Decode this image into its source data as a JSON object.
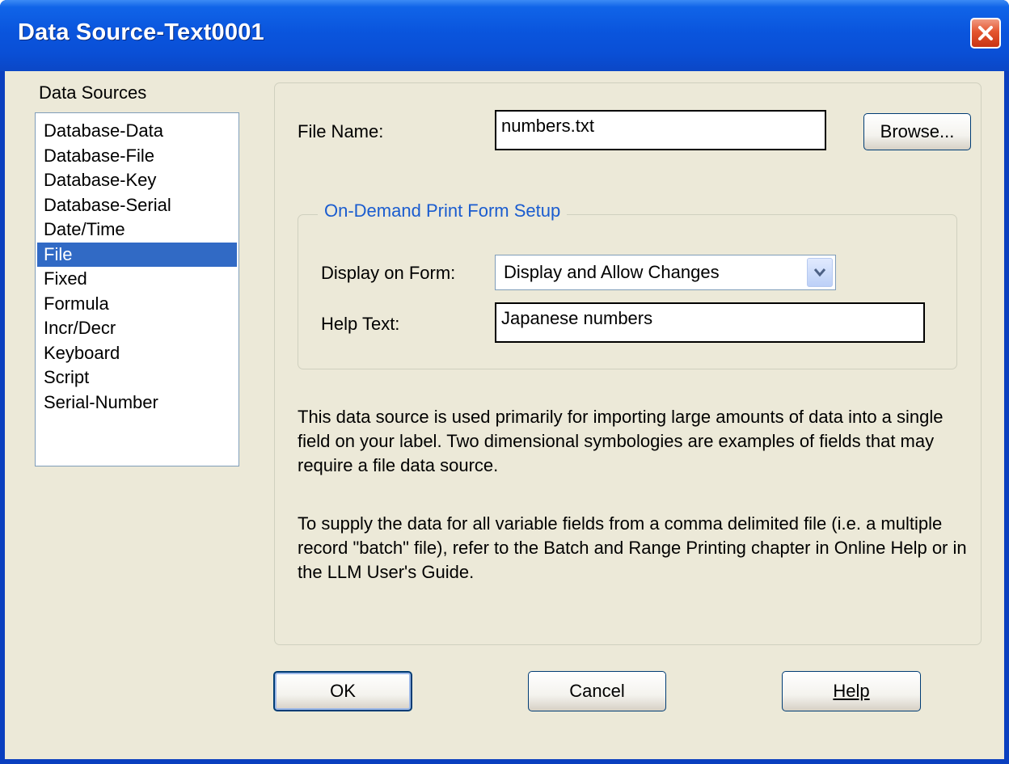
{
  "window": {
    "title": "Data Source-Text0001",
    "close_icon": "close-icon"
  },
  "sources": {
    "label": "Data Sources",
    "items": [
      {
        "label": "Database-Data",
        "selected": false
      },
      {
        "label": "Database-File",
        "selected": false
      },
      {
        "label": "Database-Key",
        "selected": false
      },
      {
        "label": "Database-Serial",
        "selected": false
      },
      {
        "label": "Date/Time",
        "selected": false
      },
      {
        "label": "File",
        "selected": true
      },
      {
        "label": "Fixed",
        "selected": false
      },
      {
        "label": "Formula",
        "selected": false
      },
      {
        "label": "Incr/Decr",
        "selected": false
      },
      {
        "label": "Keyboard",
        "selected": false
      },
      {
        "label": "Script",
        "selected": false
      },
      {
        "label": "Serial-Number",
        "selected": false
      }
    ]
  },
  "file": {
    "label": "File Name:",
    "value": "numbers.txt",
    "browse_label": "Browse..."
  },
  "on_demand": {
    "title": "On-Demand Print Form Setup",
    "display_label": "Display on Form:",
    "display_value": "Display and Allow Changes",
    "help_label": "Help Text:",
    "help_value": "Japanese numbers"
  },
  "description": {
    "para1": "This data source is used primarily for importing large amounts of data into a single field on your label.  Two dimensional symbologies are examples of fields that may require a file data source.",
    "para2": "To supply the data for all variable fields from a comma delimited file (i.e. a multiple record \"batch\" file), refer to  the Batch and Range Printing chapter in Online Help or in the LLM User's Guide."
  },
  "buttons": {
    "ok": "OK",
    "cancel": "Cancel",
    "help": "Help"
  },
  "colors": {
    "titlebar": "#0a55dd",
    "selection": "#316ac5",
    "dialog_bg": "#ece9d8",
    "group_title": "#1a5ccf"
  }
}
